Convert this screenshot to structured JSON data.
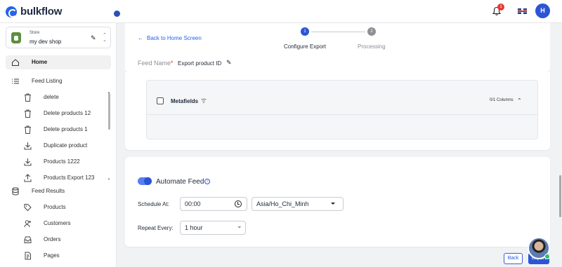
{
  "app": {
    "name": "bulkflow",
    "notification_count": "1",
    "avatar_initial": "H"
  },
  "store": {
    "caption": "Store",
    "name": "my dev shop"
  },
  "sidebar": {
    "home": "Home",
    "feed_listing": "Feed Listing",
    "feed_listing_items": [
      {
        "label": "delete",
        "icon": "trash-icon"
      },
      {
        "label": "Delete products 12",
        "icon": "trash-icon"
      },
      {
        "label": "Delete products 1",
        "icon": "trash-icon"
      },
      {
        "label": "Duplicate product",
        "icon": "download-icon"
      },
      {
        "label": "Products 1222",
        "icon": "download-icon"
      },
      {
        "label": "Products Export 123",
        "icon": "upload-icon"
      }
    ],
    "feed_results": "Feed Results",
    "feed_results_items": [
      {
        "label": "Products",
        "icon": "tag-icon"
      },
      {
        "label": "Customers",
        "icon": "person-add-icon"
      },
      {
        "label": "Orders",
        "icon": "inbox-icon"
      },
      {
        "label": "Pages",
        "icon": "pages-icon"
      }
    ]
  },
  "header": {
    "back_link": "Back to Home Screen",
    "steps": [
      {
        "number": "1",
        "label": "Configure Export"
      },
      {
        "number": "2",
        "label": "Processing"
      }
    ],
    "feed_name_label": "Feed Name",
    "feed_name_required": "*",
    "feed_name_value": "Export product ID"
  },
  "metafields": {
    "label": "Metafields",
    "column_count": "0/1 Columns"
  },
  "automate": {
    "title": "Automate Feed",
    "info": "i",
    "schedule_label": "Schedule At:",
    "time_value": "00:00",
    "timezone_value": "Asia/Ho_Chi_Minh",
    "repeat_label": "Repeat Every:",
    "repeat_value": "1 hour"
  },
  "footer": {
    "back_label": "Back",
    "export_label": "Export"
  },
  "colors": {
    "accent": "#2c55d6",
    "badge": "#e53935",
    "online": "#22c55e"
  }
}
